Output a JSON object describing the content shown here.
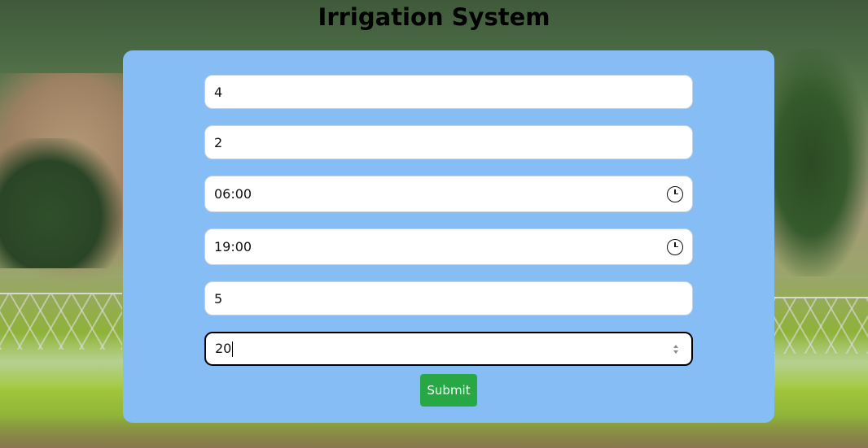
{
  "page": {
    "title": "Irrigation System"
  },
  "form": {
    "fields": [
      {
        "value": "4",
        "type": "number"
      },
      {
        "value": "2",
        "type": "number"
      },
      {
        "value": "06:00",
        "type": "time",
        "icon": "clock-icon"
      },
      {
        "value": "19:00",
        "type": "time",
        "icon": "clock-icon"
      },
      {
        "value": "5",
        "type": "number"
      },
      {
        "value": "20",
        "type": "number",
        "focused": true
      }
    ],
    "submit_label": "Submit"
  },
  "colors": {
    "card_background": "#86bdf4",
    "submit_background": "#28a745",
    "submit_text": "#ffffff",
    "title_text": "#000000"
  }
}
